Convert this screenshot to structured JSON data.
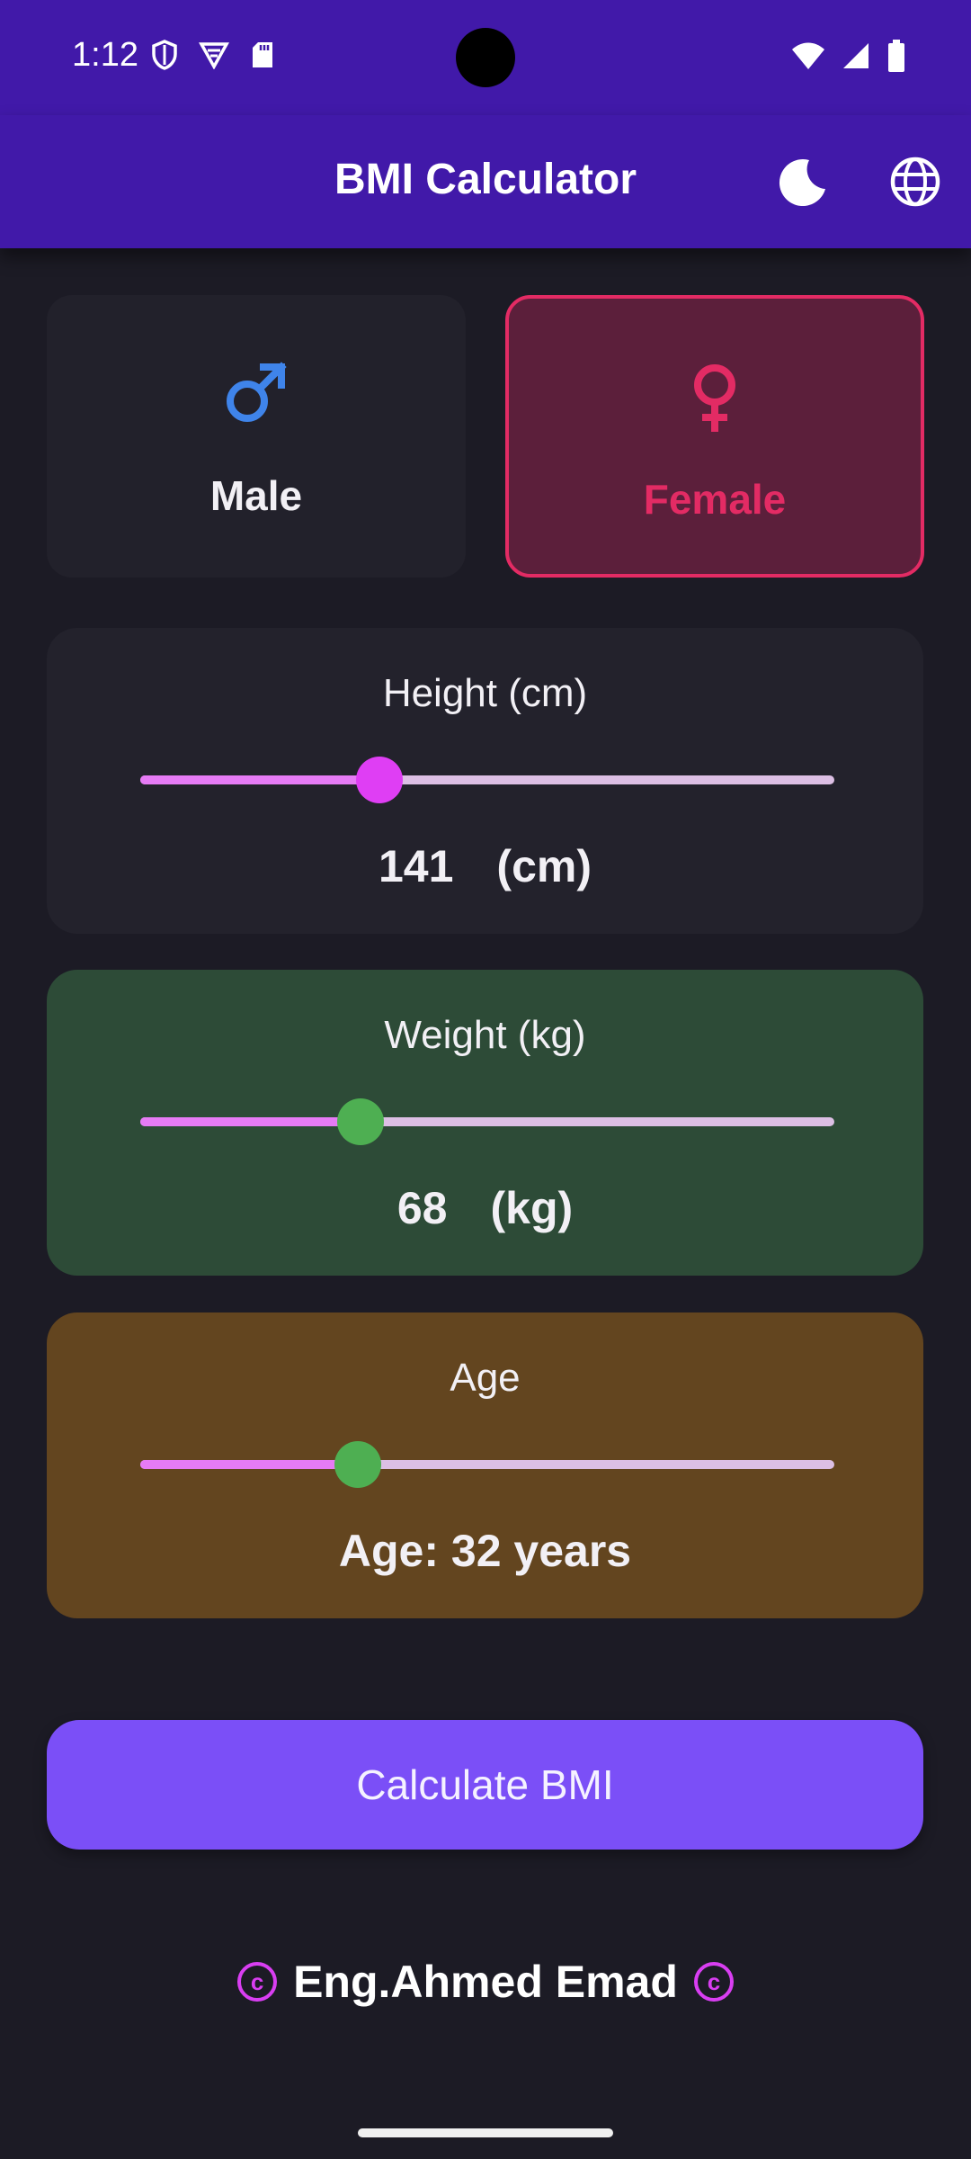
{
  "status_bar": {
    "time": "1:12"
  },
  "app_bar": {
    "title": "BMI Calculator",
    "icons": [
      "moon-icon",
      "globe-icon"
    ]
  },
  "gender": {
    "male_label": "Male",
    "female_label": "Female",
    "selected": "Female"
  },
  "height": {
    "title": "Height (cm)",
    "value": "141",
    "unit": "(cm)",
    "slider_fraction": 0.345
  },
  "weight": {
    "title": "Weight (kg)",
    "value": "68",
    "unit": "(kg)",
    "slider_fraction": 0.318
  },
  "age": {
    "title": "Age",
    "value_text": "Age: 32 years",
    "slider_fraction": 0.313
  },
  "calculate_label": "Calculate BMI",
  "credit": {
    "name": "Eng.Ahmed Emad",
    "symbol": "c"
  },
  "colors": {
    "app_bar": "#4119a9",
    "background": "#1c1b25",
    "female_accent": "#e32b64",
    "male_accent": "#3f84ea",
    "button": "#7b4ff7"
  }
}
